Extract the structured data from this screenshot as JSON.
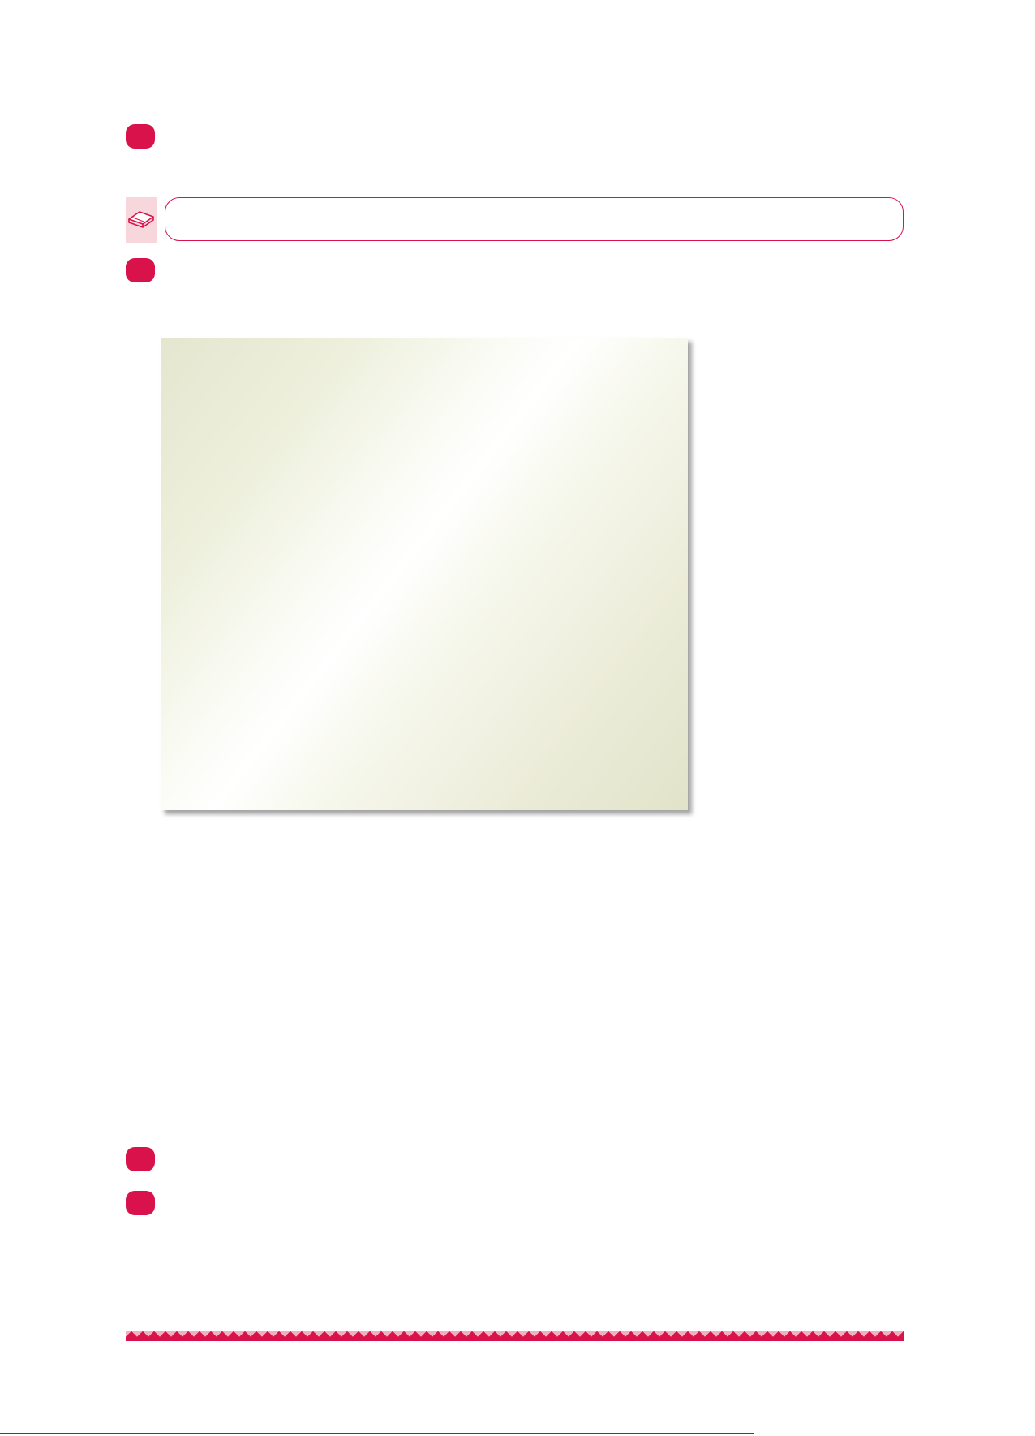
{
  "colors": {
    "accent": "#d9124b",
    "accent_light": "#f7d6dc",
    "panel_tint": "#e4e6cf"
  },
  "steps": [
    {
      "label": "",
      "text": ""
    },
    {
      "label": "",
      "text": ""
    },
    {
      "label": "",
      "text": ""
    },
    {
      "label": "",
      "text": ""
    }
  ],
  "note": {
    "icon": "book-icon",
    "text": ""
  },
  "footer": {
    "text": ""
  }
}
